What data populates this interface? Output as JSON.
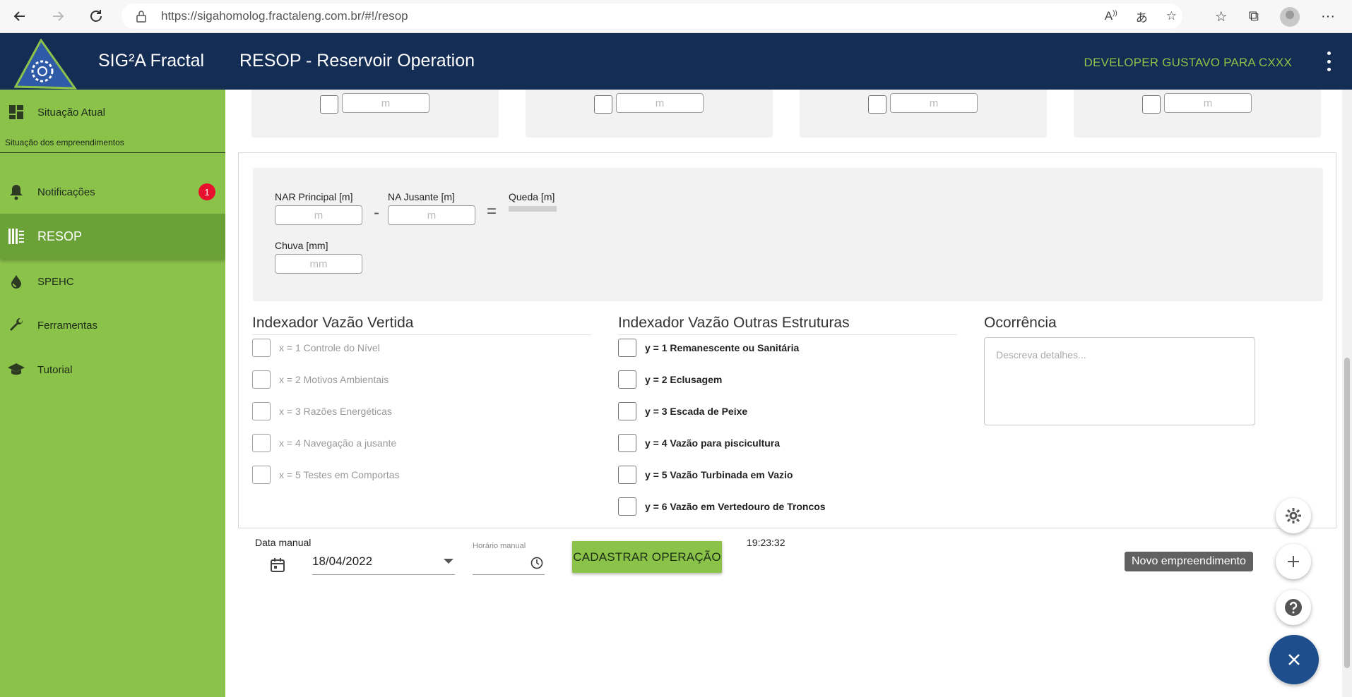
{
  "browser": {
    "url": "https://sigahomolog.fractaleng.com.br/#!/resop"
  },
  "header": {
    "app_name": "SIG²A Fractal",
    "page_title": "RESOP - Reservoir Operation",
    "user": "DEVELOPER GUSTAVO PARA CXXX"
  },
  "sidebar": {
    "items": [
      {
        "label": "Situação Atual",
        "icon": "dashboard-icon"
      },
      {
        "label": "Notificações",
        "icon": "bell-icon",
        "badge": "1"
      },
      {
        "label": "RESOP",
        "icon": "resop-icon"
      },
      {
        "label": "SPEHC",
        "icon": "water-drop-icon"
      },
      {
        "label": "Ferramentas",
        "icon": "wrench-icon"
      },
      {
        "label": "Tutorial",
        "icon": "graduation-cap-icon"
      }
    ],
    "sub_label": "Situação dos empreendimentos"
  },
  "top_cards": {
    "unit_placeholder": "m"
  },
  "levels": {
    "nar_label": "NAR Principal [m]",
    "nar_placeholder": "m",
    "minus": "-",
    "na_jusante_label": "NA Jusante [m]",
    "na_jusante_placeholder": "m",
    "equals": "=",
    "queda_label": "Queda [m]",
    "chuva_label": "Chuva [mm]",
    "chuva_placeholder": "mm"
  },
  "vertida": {
    "title": "Indexador Vazão Vertida",
    "options": [
      "x = 1 Controle do Nível",
      "x = 2 Motivos Ambientais",
      "x = 3 Razões Energéticas",
      "x = 4 Navegação a jusante",
      "x = 5 Testes em Comportas"
    ]
  },
  "outras": {
    "title": "Indexador Vazão Outras Estruturas",
    "options": [
      "y = 1 Remanescente ou Sanitária",
      "y = 2 Eclusagem",
      "y = 3 Escada de Peixe",
      "y = 4 Vazão para piscicultura",
      "y = 5 Vazão Turbinada em Vazio",
      "y = 6 Vazão em Vertedouro de Troncos"
    ]
  },
  "ocorrencia": {
    "title": "Ocorrência",
    "placeholder": "Descreva detalhes..."
  },
  "bottom": {
    "data_manual_label": "Data manual",
    "date_value": "18/04/2022",
    "horario_label": "Horário manual",
    "cadastrar_label": "CADASTRAR OPERAÇÃO",
    "time_display": "19:23:32"
  },
  "fab": {
    "tooltip": "Novo empreendimento"
  },
  "colors": {
    "header_bg": "#142d55",
    "sidebar_bg": "#8bc34a",
    "sidebar_active": "#6aa237",
    "accent_green": "#8bc34a",
    "badge_red": "#e8112d",
    "fab_main": "#1e4e8c"
  }
}
